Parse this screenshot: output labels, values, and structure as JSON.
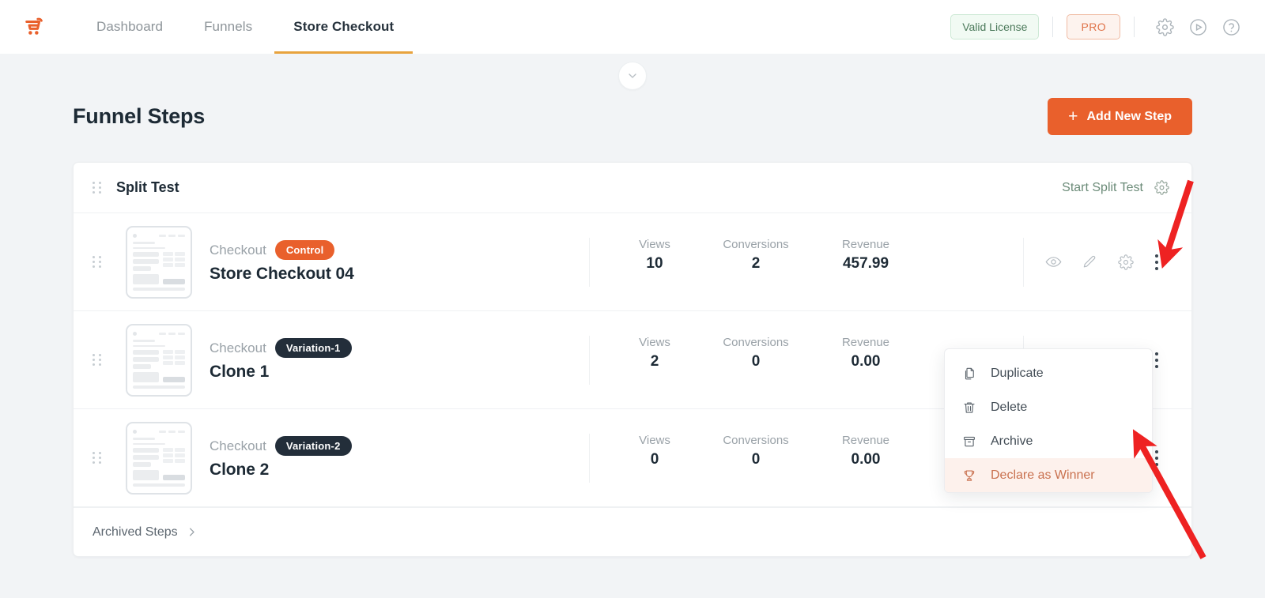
{
  "nav": {
    "logo_icon": "cartflows-logo-icon",
    "items": [
      {
        "label": "Dashboard",
        "active": false
      },
      {
        "label": "Funnels",
        "active": false
      },
      {
        "label": "Store Checkout",
        "active": true
      }
    ],
    "license_badge": "Valid License",
    "pro_badge": "PRO",
    "icons": [
      "gear-icon",
      "play-circle-icon",
      "help-circle-icon"
    ]
  },
  "collapse": {
    "icon": "chevron-down-icon"
  },
  "page": {
    "title": "Funnel Steps",
    "add_button": {
      "label": "Add New Step",
      "plus": "+"
    }
  },
  "card": {
    "header": {
      "title": "Split Test",
      "start_label": "Start Split Test",
      "gear_icon": "gear-icon",
      "drag_icon": "drag-handle-icon"
    },
    "stat_labels": {
      "views": "Views",
      "conversions": "Conversions",
      "revenue": "Revenue"
    },
    "rows": [
      {
        "type": "Checkout",
        "pill": "Control",
        "pill_style": "control",
        "name": "Store Checkout 04",
        "views": "10",
        "conversions": "2",
        "revenue": "457.99",
        "actions": [
          "eye-icon",
          "pencil-icon",
          "gear-icon",
          "kebab-menu-icon"
        ]
      },
      {
        "type": "Checkout",
        "pill": "Variation-1",
        "pill_style": "variation",
        "name": "Clone 1",
        "views": "2",
        "conversions": "0",
        "revenue": "0.00",
        "actions": [
          "eye-icon",
          "pencil-icon",
          "gear-icon",
          "kebab-menu-icon"
        ]
      },
      {
        "type": "Checkout",
        "pill": "Variation-2",
        "pill_style": "variation",
        "name": "Clone 2",
        "views": "0",
        "conversions": "0",
        "revenue": "0.00",
        "actions": [
          "eye-icon",
          "pencil-icon",
          "gear-icon",
          "kebab-menu-icon"
        ]
      }
    ],
    "footer": {
      "archived_label": "Archived Steps",
      "chevron": "chevron-right-icon"
    }
  },
  "dropdown": {
    "items": [
      {
        "label": "Duplicate",
        "icon": "duplicate-icon",
        "highlighted": false
      },
      {
        "label": "Delete",
        "icon": "trash-icon",
        "highlighted": false
      },
      {
        "label": "Archive",
        "icon": "archive-box-icon",
        "highlighted": false
      },
      {
        "label": "Declare as Winner",
        "icon": "trophy-icon",
        "highlighted": true
      }
    ]
  },
  "annotations": {
    "arrow_color": "#ee2222",
    "arrows": [
      {
        "name": "arrow-to-kebab-menu"
      },
      {
        "name": "arrow-to-declare-as-winner"
      }
    ]
  },
  "colors": {
    "accent_orange": "#e9602c",
    "nav_underline": "#e8a33d",
    "dark_pill": "#232e3a",
    "page_bg": "#f2f4f6"
  }
}
